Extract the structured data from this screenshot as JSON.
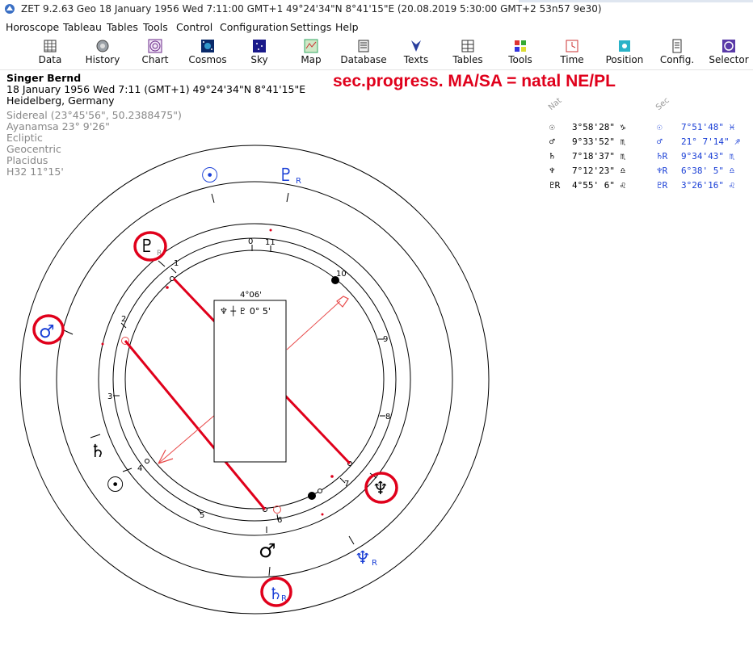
{
  "window": {
    "title": "ZET 9.2.63 Geo    18 January 1956  Wed    7:11:00 GMT+1 49°24'34\"N  8°41'15\"E    (20.08.2019    5:30:00 GMT+2 53n57 9e30)"
  },
  "menu": [
    "Horoscope",
    "Tableau",
    "Tables",
    "Tools",
    "Control",
    "Configuration",
    "Settings",
    "Help"
  ],
  "toolbar": [
    {
      "label": "Data",
      "icon": "data-icon"
    },
    {
      "label": "History",
      "icon": "history-icon"
    },
    {
      "label": "Chart",
      "icon": "chart-icon"
    },
    {
      "label": "Cosmos",
      "icon": "cosmos-icon"
    },
    {
      "label": "Sky",
      "icon": "sky-icon"
    },
    {
      "label": "Map",
      "icon": "map-icon"
    },
    {
      "label": "Database",
      "icon": "database-icon"
    },
    {
      "label": "Texts",
      "icon": "texts-icon"
    },
    {
      "label": "Tables",
      "icon": "tables-icon"
    },
    {
      "label": "Tools",
      "icon": "tools-icon"
    },
    {
      "label": "Time",
      "icon": "time-icon"
    },
    {
      "label": "Position",
      "icon": "position-icon"
    },
    {
      "label": "Config.",
      "icon": "config-icon"
    },
    {
      "label": "Selector",
      "icon": "selector-icon"
    }
  ],
  "info": {
    "name": "Singer Bernd",
    "date_line": "18 January 1956  Wed   7:11 (GMT+1) 49°24'34\"N  8°41'15\"E",
    "place": "Heidelberg, Germany",
    "details": [
      "Sidereal (23°45'56\", 50.2388475\")",
      "Ayanamsa 23° 9'26\"",
      "Ecliptic",
      "Geocentric",
      "Placidus",
      "H32  11°15'"
    ]
  },
  "headline": "sec.progress. MA/SA = natal NE/PL",
  "table": {
    "col_nat": "Nat",
    "col_sec": "Sec",
    "nat": [
      {
        "glyph": "☉",
        "value": "3°58'28\" ♑"
      },
      {
        "glyph": "♂",
        "value": "9°33'52\" ♏"
      },
      {
        "glyph": "♄",
        "value": "7°18'37\" ♏"
      },
      {
        "glyph": "♆",
        "value": "7°12'23\" ♎"
      },
      {
        "glyph": "♇R",
        "value": "4°55' 6\" ♌"
      }
    ],
    "sec": [
      {
        "glyph": "☉",
        "value": "7°51'48\" ♓"
      },
      {
        "glyph": "♂",
        "value": "21° 7'14\" ♐"
      },
      {
        "glyph": "♄R",
        "value": "9°34'43\" ♏"
      },
      {
        "glyph": "♆R",
        "value": "6°38' 5\" ♎"
      },
      {
        "glyph": "♇R",
        "value": "3°26'16\" ♌"
      }
    ]
  },
  "chart": {
    "house_numbers": [
      "0",
      "11",
      "1",
      "10",
      "2",
      "9",
      "3",
      "8",
      "4",
      "7",
      "5",
      "6"
    ],
    "midpoint_box_title": "4°06'",
    "midpoint_box_text": "♆ ┼ ♇   0° 5'",
    "outer_planets": [
      {
        "glyph": "☉",
        "retro": "",
        "color": "blue"
      },
      {
        "glyph": "♇",
        "retro": "R",
        "color": "blue"
      },
      {
        "glyph": "♆",
        "retro": "R",
        "color": "blue"
      },
      {
        "glyph": "♄",
        "retro": "R",
        "color": "blue",
        "circled": true
      },
      {
        "glyph": "♂",
        "retro": "",
        "color": "blue",
        "circled": true
      }
    ],
    "inner_planets": [
      {
        "glyph": "♇",
        "retro": "R",
        "color": "black",
        "circled": true
      },
      {
        "glyph": "♄",
        "retro": "",
        "color": "black"
      },
      {
        "glyph": "☉",
        "retro": "",
        "color": "black"
      },
      {
        "glyph": "♂",
        "retro": "",
        "color": "black"
      },
      {
        "glyph": "♆",
        "retro": "",
        "color": "black",
        "circled": true
      }
    ],
    "colors": {
      "natal": "#000000",
      "progressed": "#1a3fd6",
      "highlight": "#e0001b",
      "aspect": "#e84a4a"
    }
  }
}
